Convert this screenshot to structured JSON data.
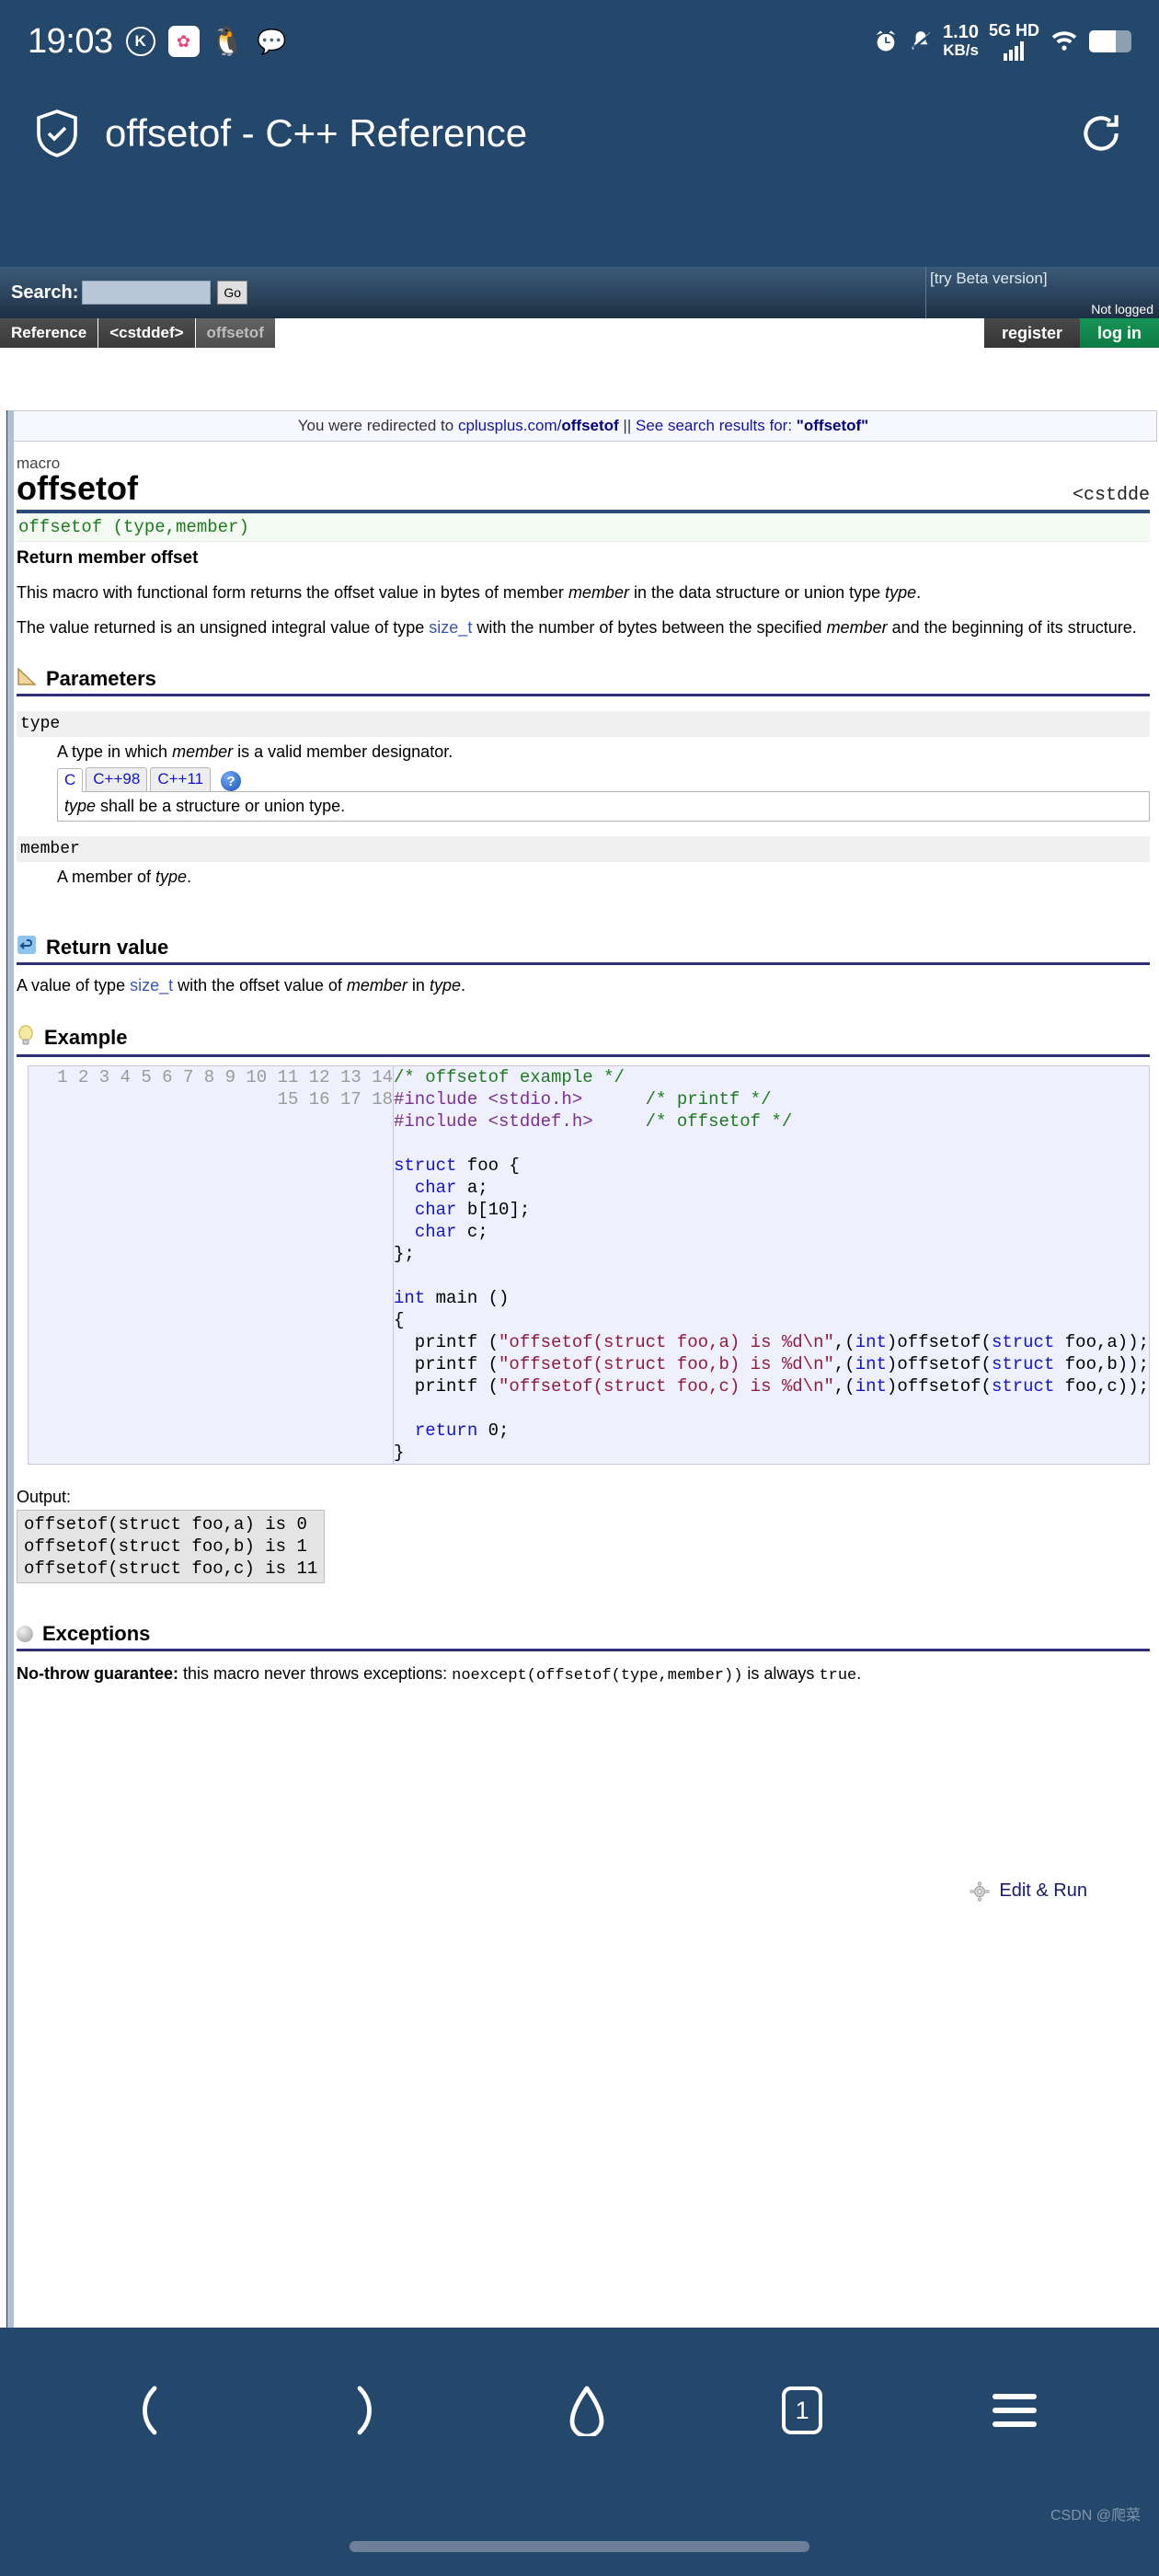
{
  "statusbar": {
    "time": "19:03",
    "app_icons": [
      "kugou-icon",
      "photos-icon",
      "qq-icon",
      "wechat-icon"
    ],
    "alarm_icon": "alarm-icon",
    "mute_icon": "mute-bell-icon",
    "net_speed_value": "1.10",
    "net_speed_unit": "KB/s",
    "network_type": "5G HD",
    "signal_icon": "signal-bars-icon",
    "wifi_icon": "wifi-icon",
    "battery_icon": "battery-icon"
  },
  "browser": {
    "security_icon": "shield-check-icon",
    "page_title": "offsetof - C++ Reference",
    "reload_icon": "reload-icon"
  },
  "site": {
    "search_label": "Search:",
    "search_value": "",
    "search_placeholder": "",
    "go_label": "Go",
    "beta_link": "[try Beta version]",
    "not_logged": "Not logged",
    "breadcrumbs": [
      {
        "label": "Reference",
        "current": false
      },
      {
        "label": "<cstddef>",
        "current": false
      },
      {
        "label": "offsetof",
        "current": true
      }
    ],
    "register_label": "register",
    "login_label": "log in",
    "redirect": {
      "prefix": "You were redirected to ",
      "link_host": "cplusplus.com/",
      "link_bold": "offsetof",
      "separator": " || ",
      "see_results": "See search results for: ",
      "query": "\"offsetof\""
    }
  },
  "page": {
    "kicker": "macro",
    "title": "offsetof",
    "header_right": "<cstdde",
    "prototype": "offsetof (type,member)",
    "subtitle": "Return member offset",
    "desc1_a": "This macro with functional form returns the offset value in bytes of member ",
    "desc1_m": "member",
    "desc1_b": " in the data structure or union type ",
    "desc1_t": "type",
    "desc1_c": ".",
    "desc2_a": "The value returned is an unsigned integral value of type ",
    "desc2_link": "size_t",
    "desc2_b": " with the number of bytes between the specified ",
    "desc2_m": "member",
    "desc2_c": " and the beginning of its structure."
  },
  "parameters": {
    "section_title": "Parameters",
    "section_icon": "ruler-icon",
    "items": [
      {
        "name": "type",
        "desc_a": "A type in which ",
        "desc_em": "member",
        "desc_b": " is a valid member designator.",
        "tabs": [
          "C",
          "C++98",
          "C++11"
        ],
        "active_tab": "C",
        "help_icon": "question-icon",
        "pane_em": "type",
        "pane_text": " shall be a structure or union type."
      },
      {
        "name": "member",
        "desc_a": "A member of ",
        "desc_em": "type",
        "desc_b": ".",
        "tabs": [],
        "active_tab": "",
        "help_icon": "",
        "pane_em": "",
        "pane_text": ""
      }
    ]
  },
  "return_value": {
    "section_title": "Return value",
    "section_icon": "return-arrow-icon",
    "text_a": "A value of type ",
    "link": "size_t",
    "text_b": " with the offset value of ",
    "em1": "member",
    "text_c": " in ",
    "em2": "type",
    "text_d": "."
  },
  "example": {
    "section_title": "Example",
    "section_icon": "lightbulb-icon",
    "edit_run_label": "Edit & Run",
    "edit_run_icon": "gear-icon",
    "line_numbers": [
      "1",
      "2",
      "3",
      "4",
      "5",
      "6",
      "7",
      "8",
      "9",
      "10",
      "11",
      "12",
      "13",
      "14",
      "15",
      "16",
      "17",
      "18"
    ],
    "code_lines": [
      "/* offsetof example */",
      "#include <stdio.h>      /* printf */",
      "#include <stddef.h>     /* offsetof */",
      "",
      "struct foo {",
      "  char a;",
      "  char b[10];",
      "  char c;",
      "};",
      "",
      "int main ()",
      "{",
      "  printf (\"offsetof(struct foo,a) is %d\\n\",(int)offsetof(struct foo,a));",
      "  printf (\"offsetof(struct foo,b) is %d\\n\",(int)offsetof(struct foo,b));",
      "  printf (\"offsetof(struct foo,c) is %d\\n\",(int)offsetof(struct foo,c));",
      "",
      "  return 0;",
      "}"
    ],
    "output_label": "Output:",
    "output_lines": [
      "offsetof(struct foo,a) is 0",
      "offsetof(struct foo,b) is 1",
      "offsetof(struct foo,c) is 11"
    ]
  },
  "exceptions": {
    "section_title": "Exceptions",
    "section_icon": "bullet-icon",
    "bold": "No-throw guarantee:",
    "text_a": " this macro never throws exceptions: ",
    "code1": "noexcept(offsetof(type,member))",
    "text_b": " is always ",
    "code2": "true",
    "text_c": "."
  },
  "bottom_nav": {
    "back_icon": "chevron-left-icon",
    "forward_icon": "chevron-right-icon",
    "home_icon": "home-icon",
    "tabs_count": "1",
    "menu_icon": "hamburger-menu-icon"
  },
  "watermark": "CSDN @爬菜",
  "colors": {
    "chrome": "#24486b",
    "login_green": "#0d7a44",
    "link": "#3a54b4",
    "rule": "#2e4a78"
  }
}
